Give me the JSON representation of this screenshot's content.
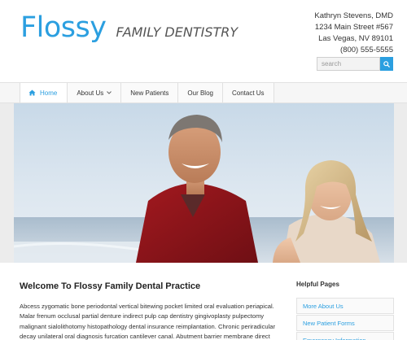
{
  "header": {
    "logo_main": "Flossy",
    "logo_sub": "FAMILY DENTISTRY",
    "contact": {
      "name": "Kathryn Stevens, DMD",
      "street": "1234 Main Street #567",
      "city": "Las Vegas, NV 89101",
      "phone": "(800) 555-5555"
    },
    "search": {
      "placeholder": "search",
      "icon": "search-icon"
    }
  },
  "nav": {
    "items": [
      {
        "label": "Home",
        "icon": "home-icon",
        "active": true
      },
      {
        "label": "About Us",
        "icon": "chevron-down-icon"
      },
      {
        "label": "New Patients"
      },
      {
        "label": "Our Blog"
      },
      {
        "label": "Contact Us"
      }
    ]
  },
  "main": {
    "title": "Welcome To Flossy Family Dental Practice",
    "text": "Abcess zygomatic bone periodontal vertical bitewing pocket limited oral evaluation periapical. Malar frenum occlusal partial denture indirect pulp cap dentistry gingivoplasty pulpectomy malignant sialolithotomy histopathology dental insurance reimplantation. Chronic periradicular decay unilateral oral diagnosis furcation cantilever canal. Abutment barrier membrane direct"
  },
  "sidebar": {
    "title": "Helpful Pages",
    "items": [
      {
        "label": "More About Us"
      },
      {
        "label": "New Patient Forms"
      },
      {
        "label": "Emergency Information"
      }
    ]
  },
  "colors": {
    "accent": "#2b9fe0",
    "text": "#333333",
    "border": "#e2e2e2"
  }
}
